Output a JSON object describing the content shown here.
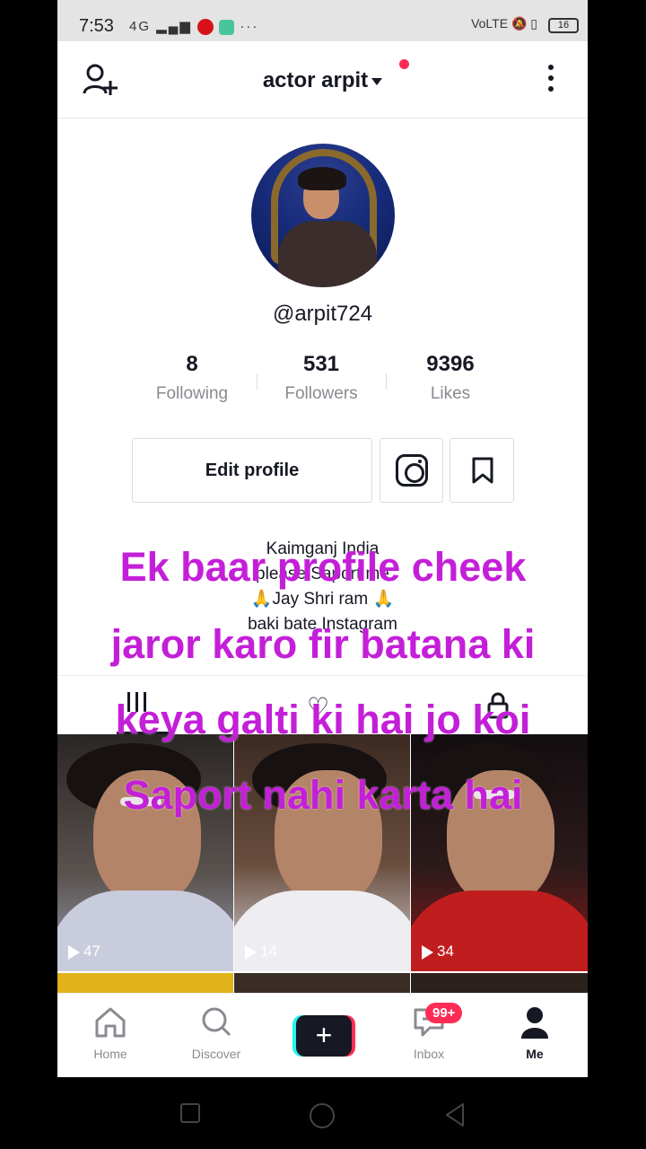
{
  "status_bar": {
    "time": "7:53",
    "network": "4G",
    "right": "VoLTE",
    "battery": "16"
  },
  "header": {
    "title": "actor arpit"
  },
  "profile": {
    "handle": "@arpit724"
  },
  "stats": [
    {
      "value": "8",
      "label": "Following"
    },
    {
      "value": "531",
      "label": "Followers"
    },
    {
      "value": "9396",
      "label": "Likes"
    }
  ],
  "buttons": {
    "edit_profile": "Edit profile"
  },
  "bio": [
    "Kaimganj India",
    "please Saport me",
    "🙏Jay Shri ram 🙏",
    "baki bate Instagram"
  ],
  "videos": [
    {
      "plays": "47"
    },
    {
      "plays": "14"
    },
    {
      "plays": "34"
    }
  ],
  "overlay": [
    "Ek baar profile cheek",
    "jaror karo fir batana ki",
    "keya galti ki hai jo koi",
    "Saport nahi karta hai"
  ],
  "nav": {
    "home": "Home",
    "discover": "Discover",
    "inbox": "Inbox",
    "inbox_badge": "99+",
    "me": "Me"
  },
  "colors": {
    "overlay_text": "#c41fd8",
    "accent_red": "#fe2c55",
    "accent_cyan": "#25f4ee"
  }
}
